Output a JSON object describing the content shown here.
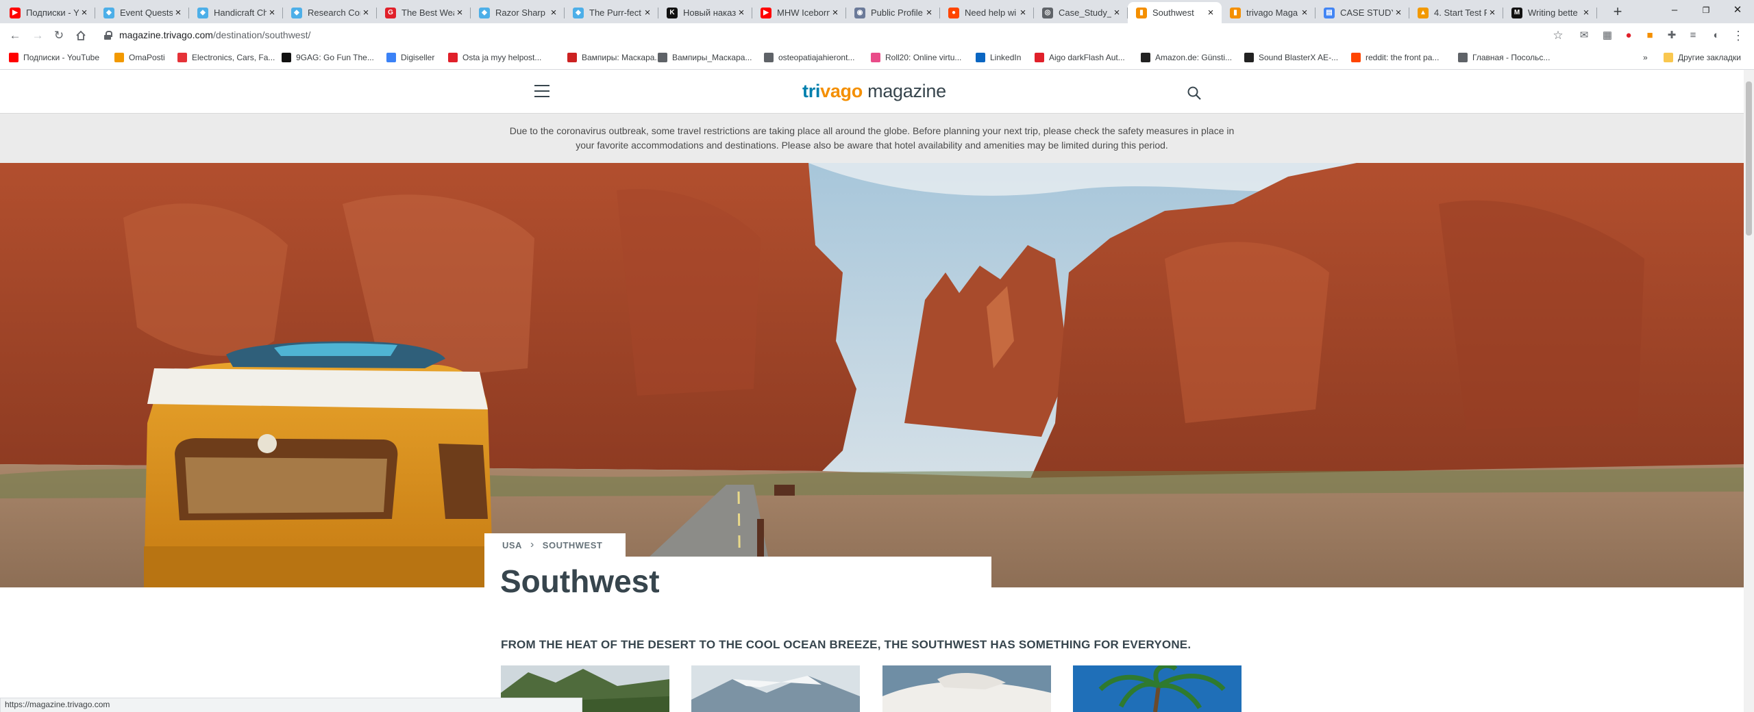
{
  "browser": {
    "tabs": [
      {
        "label": "Подписки - YouTube",
        "color": "#ff0000",
        "glyph": "▶"
      },
      {
        "label": "Event Quests",
        "color": "#4dafe8",
        "glyph": "◆"
      },
      {
        "label": "Handicraft Ch",
        "color": "#4dafe8",
        "glyph": "◆"
      },
      {
        "label": "Research Con",
        "color": "#4dafe8",
        "glyph": "◆"
      },
      {
        "label": "The Best Wea",
        "color": "#e0202a",
        "glyph": "G"
      },
      {
        "label": "Razor Sharp",
        "color": "#4dafe8",
        "glyph": "◆"
      },
      {
        "label": "The Purr-fect",
        "color": "#4dafe8",
        "glyph": "◆"
      },
      {
        "label": "Новый наказ",
        "color": "#111111",
        "glyph": "K"
      },
      {
        "label": "MHW Iceborn",
        "color": "#ff0000",
        "glyph": "▶"
      },
      {
        "label": "Public Profile",
        "color": "#6b7a99",
        "glyph": "◉"
      },
      {
        "label": "Need help wi",
        "color": "#ff4500",
        "glyph": "●"
      },
      {
        "label": "Case_Study_",
        "color": "#5f6368",
        "glyph": "◎"
      },
      {
        "label": "Southwest",
        "color": "#f48f00",
        "glyph": "▮"
      },
      {
        "label": "trivago Maga",
        "color": "#f48f00",
        "glyph": "▮"
      },
      {
        "label": "CASE STUDY",
        "color": "#4285f4",
        "glyph": "▤"
      },
      {
        "label": "4. Start Test F",
        "color": "#f29900",
        "glyph": "▲"
      },
      {
        "label": "Writing bette",
        "color": "#111111",
        "glyph": "M"
      }
    ],
    "active_tab_index": 12,
    "new_tab": "+",
    "window_controls": {
      "minimize": "–",
      "restore": "❐",
      "close": "✕"
    },
    "url_host": "magazine.trivago.com",
    "url_path": "/destination/southwest/",
    "bookmarks": [
      {
        "label": "Подписки - YouTube",
        "color": "#ff0000"
      },
      {
        "label": "OmaPosti",
        "color": "#f29900"
      },
      {
        "label": "Electronics, Cars, Fa...",
        "color": "#e53238"
      },
      {
        "label": "9GAG: Go Fun The...",
        "color": "#111111"
      },
      {
        "label": "Digiseller",
        "color": "#3b82f6"
      },
      {
        "label": "Osta ja myy helpost...",
        "color": "#e0202a"
      },
      {
        "label": "Вампиры: Маскара...",
        "color": "#cc2222"
      },
      {
        "label": "Вампиры_Маскара...",
        "color": "#5f6368"
      },
      {
        "label": "osteopatiajahieront...",
        "color": "#5f6368"
      },
      {
        "label": "Roll20: Online virtu...",
        "color": "#e94c89"
      },
      {
        "label": "LinkedIn",
        "color": "#0a66c2"
      },
      {
        "label": "Aigo darkFlash Aut...",
        "color": "#e0202a"
      },
      {
        "label": "Amazon.de: Günsti...",
        "color": "#222222"
      },
      {
        "label": "Sound BlasterX AE-...",
        "color": "#222222"
      },
      {
        "label": "reddit: the front pa...",
        "color": "#ff4500"
      },
      {
        "label": "Главная - Посольс...",
        "color": "#5f6368"
      }
    ],
    "bookmarks_more": "»",
    "other_bookmarks": "Другие закладки",
    "status_url": "https://magazine.trivago.com"
  },
  "site": {
    "logo_part1": "tri",
    "logo_part2": "vago",
    "logo_part3": " magazine",
    "notice": "Due to the coronavirus outbreak, some travel restrictions are taking place all around the globe. Before planning your next trip, please check the safety measures in place in your favorite accommodations and destinations. Please also be aware that hotel availability and amenities may be limited during this period.",
    "breadcrumb": [
      "USA",
      "SOUTHWEST"
    ],
    "breadcrumb_sep": "›",
    "title": "Southwest",
    "tagline": "FROM THE HEAT OF THE DESERT TO THE COOL OCEAN BREEZE, THE SOUTHWEST HAS SOMETHING FOR EVERYONE."
  }
}
